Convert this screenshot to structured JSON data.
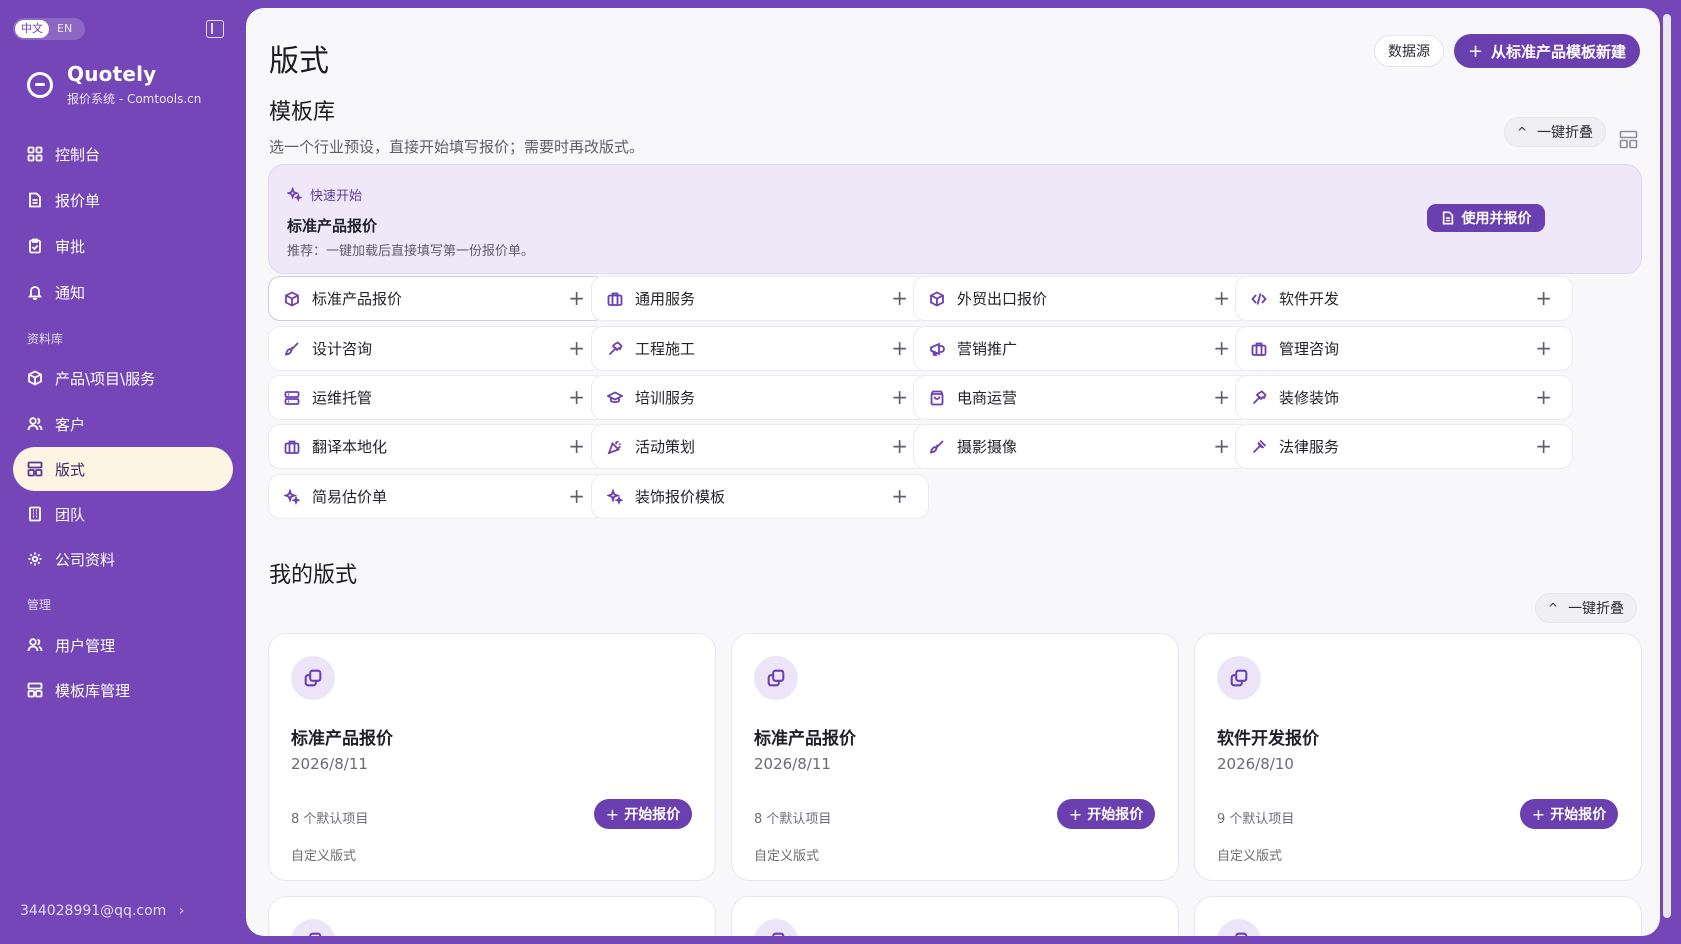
{
  "sidebar": {
    "lang": {
      "zh": "中文",
      "en": "EN"
    },
    "brand": {
      "name": "Quotely",
      "subtitle": "报价系统 - Comtools.cn"
    },
    "items_top": [
      {
        "label": "控制台",
        "icon": "grid-icon"
      },
      {
        "label": "报价单",
        "icon": "document-icon"
      },
      {
        "label": "审批",
        "icon": "clipboard-check-icon"
      },
      {
        "label": "通知",
        "icon": "bell-icon"
      }
    ],
    "section_library": "资料库",
    "items_library": [
      {
        "label": "产品\\项目\\服务",
        "icon": "box-icon"
      },
      {
        "label": "客户",
        "icon": "users-icon"
      },
      {
        "label": "版式",
        "icon": "layout-icon",
        "active": true
      },
      {
        "label": "团队",
        "icon": "building-icon"
      },
      {
        "label": "公司资料",
        "icon": "gear-icon"
      }
    ],
    "section_admin": "管理",
    "items_admin": [
      {
        "label": "用户管理",
        "icon": "users-icon"
      },
      {
        "label": "模板库管理",
        "icon": "layout-icon"
      }
    ],
    "user_email": "344028991@qq.com",
    "user_chevron": "›"
  },
  "header": {
    "title": "版式",
    "datasource_label": "数据源",
    "new_label": "从标准产品模板新建",
    "new_plus": "+"
  },
  "library": {
    "title": "模板库",
    "description": "选一个行业预设，直接开始填写报价；需要时再改版式。",
    "collapse_label": "一键折叠",
    "collapse_caret": "^",
    "quick": {
      "label": "快速开始",
      "title": "标准产品报价",
      "tip": "推荐：一键加载后直接填写第一份报价单。",
      "button": "使用并报价"
    },
    "tile_plus": "+",
    "tiles": [
      {
        "label": "标准产品报价",
        "icon": "box-icon",
        "selected": true
      },
      {
        "label": "通用服务",
        "icon": "briefcase-icon"
      },
      {
        "label": "外贸出口报价",
        "icon": "box-icon"
      },
      {
        "label": "软件开发",
        "icon": "code-icon"
      },
      {
        "label": "设计咨询",
        "icon": "brush-icon"
      },
      {
        "label": "工程施工",
        "icon": "hammer-icon"
      },
      {
        "label": "营销推广",
        "icon": "megaphone-icon"
      },
      {
        "label": "管理咨询",
        "icon": "briefcase-icon"
      },
      {
        "label": "运维托管",
        "icon": "server-icon"
      },
      {
        "label": "培训服务",
        "icon": "graduation-cap-icon"
      },
      {
        "label": "电商运营",
        "icon": "shopping-bag-icon"
      },
      {
        "label": "装修装饰",
        "icon": "hammer-icon"
      },
      {
        "label": "翻译本地化",
        "icon": "briefcase-icon"
      },
      {
        "label": "活动策划",
        "icon": "party-popper-icon"
      },
      {
        "label": "摄影摄像",
        "icon": "brush-icon"
      },
      {
        "label": "法律服务",
        "icon": "gavel-icon"
      },
      {
        "label": "简易估价单",
        "icon": "sparkles-icon"
      },
      {
        "label": "装饰报价模板",
        "icon": "sparkles-icon"
      }
    ]
  },
  "mine": {
    "title": "我的版式",
    "collapse_label": "一键折叠",
    "collapse_caret": "^",
    "start_label": "开始报价",
    "start_plus": "+",
    "cards": [
      {
        "title": "标准产品报价",
        "date": "2026/8/11",
        "count": "8 个默认项目",
        "tag": "自定义版式"
      },
      {
        "title": "标准产品报价",
        "date": "2026/8/11",
        "count": "8 个默认项目",
        "tag": "自定义版式"
      },
      {
        "title": "软件开发报价",
        "date": "2026/8/10",
        "count": "9 个默认项目",
        "tag": "自定义版式"
      }
    ]
  },
  "colors": {
    "accent": "#6a3fb0",
    "sidebar": "#7446b8",
    "active_nav": "#fdf5e2"
  }
}
